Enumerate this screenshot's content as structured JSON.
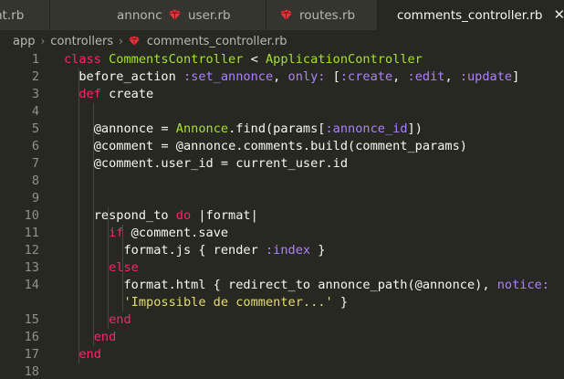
{
  "tabs": [
    {
      "label": "nt.rb",
      "active": false
    },
    {
      "label": "annonce.rb",
      "active": false
    },
    {
      "label": "user.rb",
      "active": false
    },
    {
      "label": "routes.rb",
      "active": false
    },
    {
      "label": "comments_controller.rb",
      "active": true
    }
  ],
  "breadcrumb": [
    "app",
    "controllers",
    "comments_controller.rb"
  ],
  "icons": {
    "ruby": "ruby-gem-icon",
    "close": "close-icon",
    "chevron": "chevron-right-icon"
  },
  "colors": {
    "background": "#272822",
    "keyword": "#f92672",
    "class": "#a6e22e",
    "symbol": "#ae81ff",
    "string": "#e6db74"
  },
  "editor": {
    "line_numbers": [
      "1",
      "2",
      "3",
      "4",
      "5",
      "6",
      "7",
      "8",
      "9",
      "10",
      "11",
      "12",
      "13",
      "14",
      "",
      "15",
      "16",
      "17",
      "18"
    ],
    "lines": [
      [
        {
          "t": "class ",
          "c": "kw"
        },
        {
          "t": "CommentsController",
          "c": "cls"
        },
        {
          "t": " < ",
          "c": "plain"
        },
        {
          "t": "ApplicationController",
          "c": "cls"
        }
      ],
      [
        {
          "t": "  before_action ",
          "c": "plain"
        },
        {
          "t": ":set_annonce",
          "c": "sym"
        },
        {
          "t": ", ",
          "c": "plain"
        },
        {
          "t": "only:",
          "c": "sym"
        },
        {
          "t": " [",
          "c": "plain"
        },
        {
          "t": ":create",
          "c": "sym"
        },
        {
          "t": ", ",
          "c": "plain"
        },
        {
          "t": ":edit",
          "c": "sym"
        },
        {
          "t": ", ",
          "c": "plain"
        },
        {
          "t": ":update",
          "c": "sym"
        },
        {
          "t": "]",
          "c": "plain"
        }
      ],
      [
        {
          "t": "  def ",
          "c": "kw"
        },
        {
          "t": "create",
          "c": "plain"
        }
      ],
      [],
      [
        {
          "t": "    @annonce",
          "c": "ivar"
        },
        {
          "t": " = ",
          "c": "plain"
        },
        {
          "t": "Annonce",
          "c": "cls"
        },
        {
          "t": ".find(params[",
          "c": "plain"
        },
        {
          "t": ":annonce_id",
          "c": "sym"
        },
        {
          "t": "])",
          "c": "plain"
        }
      ],
      [
        {
          "t": "    @comment",
          "c": "ivar"
        },
        {
          "t": " = ",
          "c": "plain"
        },
        {
          "t": "@annonce",
          "c": "ivar"
        },
        {
          "t": ".comments.build(comment_params)",
          "c": "plain"
        }
      ],
      [
        {
          "t": "    @comment",
          "c": "ivar"
        },
        {
          "t": ".user_id = current_user.id",
          "c": "plain"
        }
      ],
      [],
      [],
      [
        {
          "t": "    respond_to ",
          "c": "plain"
        },
        {
          "t": "do",
          "c": "kw"
        },
        {
          "t": " |format|",
          "c": "plain"
        }
      ],
      [
        {
          "t": "      if ",
          "c": "kw"
        },
        {
          "t": "@comment",
          "c": "ivar"
        },
        {
          "t": ".save",
          "c": "plain"
        }
      ],
      [
        {
          "t": "        format.js { render ",
          "c": "plain"
        },
        {
          "t": ":index",
          "c": "sym"
        },
        {
          "t": " }",
          "c": "plain"
        }
      ],
      [
        {
          "t": "      else",
          "c": "kw"
        }
      ],
      [
        {
          "t": "        format.html { redirect_to annonce_path(",
          "c": "plain"
        },
        {
          "t": "@annonce",
          "c": "ivar"
        },
        {
          "t": "), ",
          "c": "plain"
        },
        {
          "t": "notice:",
          "c": "sym"
        }
      ],
      [
        {
          "t": "        'Impossible de commenter...'",
          "c": "str"
        },
        {
          "t": " }",
          "c": "plain"
        }
      ],
      [
        {
          "t": "      end",
          "c": "kw"
        }
      ],
      [
        {
          "t": "    end",
          "c": "kw"
        }
      ],
      [
        {
          "t": "  end",
          "c": "kw"
        }
      ],
      []
    ]
  }
}
